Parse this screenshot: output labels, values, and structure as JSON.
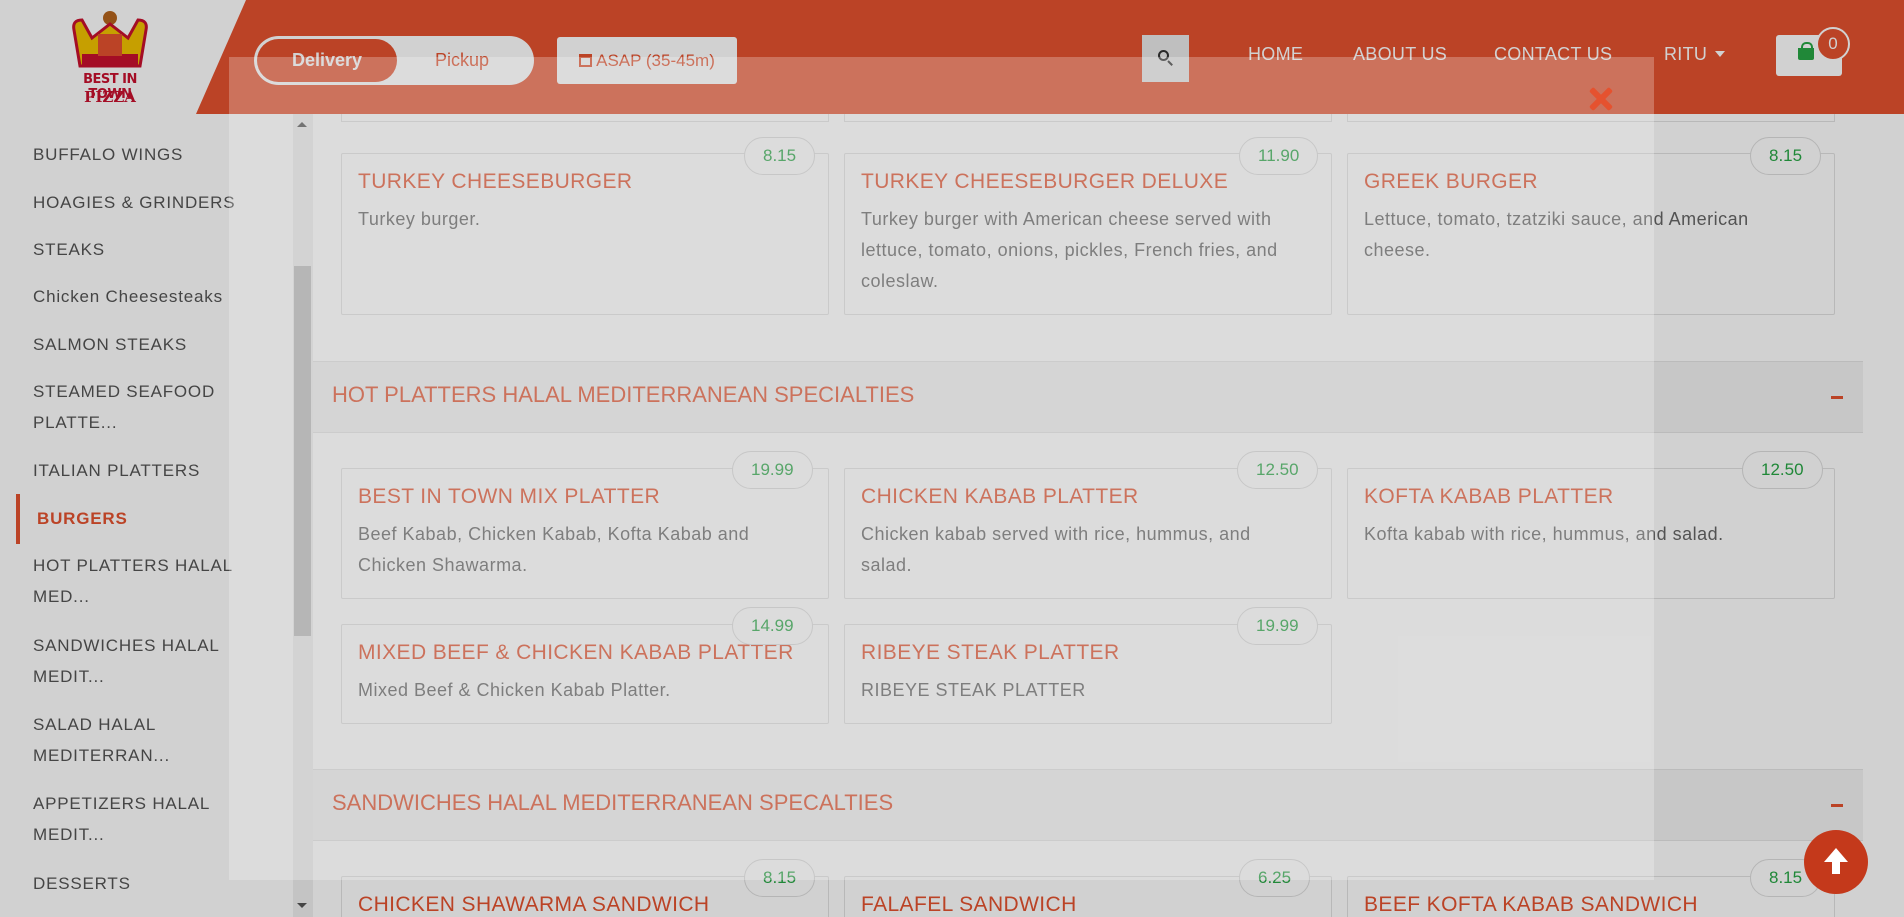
{
  "header": {
    "logo_line1": "BEST IN TOWN",
    "logo_line2": "PIZZA",
    "delivery_label": "Delivery",
    "pickup_label": "Pickup",
    "asap_label": "ASAP (35-45m)",
    "nav": [
      "HOME",
      "ABOUT US",
      "CONTACT US"
    ],
    "user_label": "RITU",
    "cart_count": "0",
    "accent_color": "#e5522f"
  },
  "sidebar": {
    "categories": [
      "BUFFALO WINGS",
      "HOAGIES & GRINDERS",
      "STEAKS",
      "Chicken Cheesesteaks",
      "SALMON STEAKS",
      "STEAMED SEAFOOD PLATTE...",
      "ITALIAN PLATTERS",
      "BURGERS",
      "HOT PLATTERS HALAL MED...",
      "SANDWICHES HALAL MEDIT...",
      "SALAD HALAL MEDITERRAN...",
      "APPETIZERS HALAL MEDIT...",
      "DESSERTS"
    ],
    "active": "BURGERS"
  },
  "burgers": [
    {
      "name": "TURKEY CHEESEBURGER",
      "desc": "Turkey burger.",
      "price": "8.15"
    },
    {
      "name": "TURKEY CHEESEBURGER DELUXE",
      "desc": "Turkey burger with American cheese served with lettuce, tomato, onions, pickles, French fries, and coleslaw.",
      "price": "11.90"
    },
    {
      "name": "GREEK BURGER",
      "desc": "Lettuce, tomato, tzatziki sauce, and American cheese.",
      "price": "8.15"
    }
  ],
  "hot_platters": {
    "title": "HOT PLATTERS HALAL MEDITERRANEAN SPECIALTIES",
    "items": [
      {
        "name": "BEST IN TOWN MIX PLATTER",
        "desc": "Beef Kabab, Chicken Kabab, Kofta Kabab and Chicken Shawarma.",
        "price": "19.99"
      },
      {
        "name": "CHICKEN KABAB PLATTER",
        "desc": "Chicken kabab served with rice, hummus, and salad.",
        "price": "12.50"
      },
      {
        "name": "KOFTA KABAB PLATTER",
        "desc": "Kofta kabab with rice, hummus, and salad.",
        "price": "12.50"
      },
      {
        "name": "MIXED BEEF & CHICKEN KABAB PLATTER",
        "desc": "Mixed Beef & Chicken Kabab Platter.",
        "price": "14.99"
      },
      {
        "name": "RIBEYE STEAK PLATTER",
        "desc": "RIBEYE STEAK PLATTER",
        "price": "19.99"
      }
    ]
  },
  "sandwiches": {
    "title": "SANDWICHES HALAL MEDITERRANEAN SPECALTIES",
    "items": [
      {
        "name": "CHICKEN SHAWARMA SANDWICH",
        "price": "8.15"
      },
      {
        "name": "FALAFEL SANDWICH",
        "price": "6.25"
      },
      {
        "name": "BEEF KOFTA KABAB SANDWICH",
        "price": "8.15"
      }
    ]
  },
  "icons": {
    "calendar": "calendar-icon",
    "search": "search-icon",
    "cart": "shopping-bag-icon",
    "close": "close-icon",
    "collapse": "minus-icon",
    "to_top": "arrow-up-icon"
  }
}
